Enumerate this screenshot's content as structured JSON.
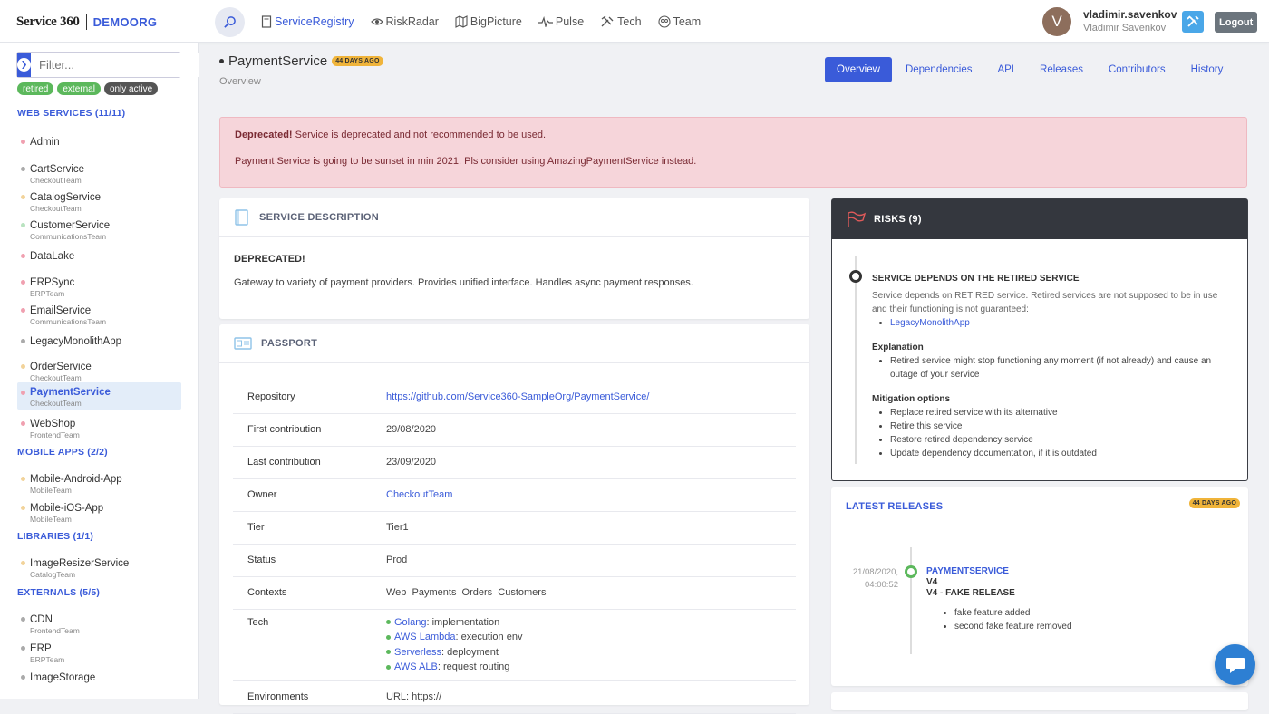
{
  "brand": {
    "name": "Service 360",
    "org": "DEMOORG"
  },
  "nav": [
    {
      "label": "ServiceRegistry",
      "icon": "document-icon",
      "active": true
    },
    {
      "label": "RiskRadar",
      "icon": "eye-icon"
    },
    {
      "label": "BigPicture",
      "icon": "map-icon"
    },
    {
      "label": "Pulse",
      "icon": "pulse-icon"
    },
    {
      "label": "Tech",
      "icon": "tools-icon"
    },
    {
      "label": "Team",
      "icon": "team-icon"
    }
  ],
  "user": {
    "initial": "V",
    "login": "vladimir.savenkov",
    "full_name": "Vladimir Savenkov",
    "logout_label": "Logout"
  },
  "sidebar": {
    "filter_placeholder": "Filter...",
    "chips": [
      "retired",
      "external",
      "only active"
    ],
    "sections": [
      {
        "title": "WEB SERVICES (11/11)",
        "items": [
          {
            "name": "Admin",
            "team": "",
            "dot": "#f0a0b0"
          },
          {
            "name": "CartService",
            "team": "CheckoutTeam",
            "dot": "#aaa"
          },
          {
            "name": "CatalogService",
            "team": "CheckoutTeam",
            "dot": "#f2d39a"
          },
          {
            "name": "CustomerService",
            "team": "CommunicationsTeam",
            "dot": "#b9e3c0"
          },
          {
            "name": "DataLake",
            "team": "",
            "dot": "#f0a0b0"
          },
          {
            "name": "ERPSync",
            "team": "ERPTeam",
            "dot": "#f0a0b0"
          },
          {
            "name": "EmailService",
            "team": "CommunicationsTeam",
            "dot": "#f0a0b0"
          },
          {
            "name": "LegacyMonolithApp",
            "team": "",
            "dot": "#aaa"
          },
          {
            "name": "OrderService",
            "team": "CheckoutTeam",
            "dot": "#f2d39a"
          },
          {
            "name": "PaymentService",
            "team": "CheckoutTeam",
            "dot": "#f0a0b0"
          },
          {
            "name": "WebShop",
            "team": "FrontendTeam",
            "dot": "#f0a0b0"
          }
        ]
      },
      {
        "title": "MOBILE APPS (2/2)",
        "items": [
          {
            "name": "Mobile-Android-App",
            "team": "MobileTeam",
            "dot": "#f2d39a"
          },
          {
            "name": "Mobile-iOS-App",
            "team": "MobileTeam",
            "dot": "#f2d39a"
          }
        ]
      },
      {
        "title": "LIBRARIES (1/1)",
        "items": [
          {
            "name": "ImageResizerService",
            "team": "CatalogTeam",
            "dot": "#f2d39a"
          }
        ]
      },
      {
        "title": "EXTERNALS (5/5)",
        "items": [
          {
            "name": "CDN",
            "team": "FrontendTeam",
            "dot": "#aaa"
          },
          {
            "name": "ERP",
            "team": "ERPTeam",
            "dot": "#aaa"
          },
          {
            "name": "ImageStorage",
            "team": "",
            "dot": "#aaa"
          }
        ]
      }
    ]
  },
  "service": {
    "title": "PaymentService",
    "age": "44 DAYS AGO",
    "subtitle": "Overview"
  },
  "tabs": [
    "Overview",
    "Dependencies",
    "API",
    "Releases",
    "Contributors",
    "History"
  ],
  "alert": {
    "strong": "Deprecated!",
    "line1": " Service is deprecated and not recommended to be used.",
    "line2": "Payment Service is going to be sunset in min 2021. Pls consider using AmazingPaymentService instead."
  },
  "description": {
    "header": "SERVICE DESCRIPTION",
    "title": "DEPRECATED!",
    "text": "Gateway to variety of payment providers. Provides unified interface. Handles async payment responses."
  },
  "passport": {
    "header": "PASSPORT",
    "rows": [
      {
        "key": "Repository",
        "value": "https://github.com/Service360-SampleOrg/PaymentService/",
        "link": true
      },
      {
        "key": "First contribution",
        "value": "29/08/2020"
      },
      {
        "key": "Last contribution",
        "value": "23/09/2020"
      },
      {
        "key": "Owner",
        "value": "CheckoutTeam",
        "link": true
      },
      {
        "key": "Tier",
        "value": "Tier1"
      },
      {
        "key": "Status",
        "value": "Prod"
      },
      {
        "key": "Contexts",
        "value": "Web  Payments  Orders  Customers"
      }
    ],
    "tech_key": "Tech",
    "tech": [
      {
        "name": "Golang",
        "purpose": ": implementation"
      },
      {
        "name": "AWS Lambda",
        "purpose": ": execution env"
      },
      {
        "name": "Serverless",
        "purpose": ": deployment"
      },
      {
        "name": "AWS ALB",
        "purpose": ": request routing"
      }
    ],
    "env_key": "Environments",
    "env_value": "URL: https://"
  },
  "risks": {
    "header": "RISKS (9)",
    "title": "SERVICE DEPENDS ON THE RETIRED SERVICE",
    "text": "Service depends on RETIRED service. Retired services are not supposed to be in use and their functioning is not guaranteed:",
    "dep": "LegacyMonolithApp",
    "explanation_h": "Explanation",
    "explanation": "Retired service might stop functioning any moment (if not already) and cause an outage of your service",
    "mitigation_h": "Mitigation options",
    "mitigation": [
      "Replace retired service with its alternative",
      "Retire this service",
      "Restore retired dependency service",
      "Update dependency documentation, if it is outdated"
    ]
  },
  "releases": {
    "header": "LATEST RELEASES",
    "age": "44 DAYS AGO",
    "date": "21/08/2020,",
    "time": "04:00:52",
    "service": "PAYMENTSERVICE",
    "version": "V4",
    "name": "V4 - FAKE RELEASE",
    "changes": [
      "fake feature added",
      "second fake feature removed"
    ]
  }
}
